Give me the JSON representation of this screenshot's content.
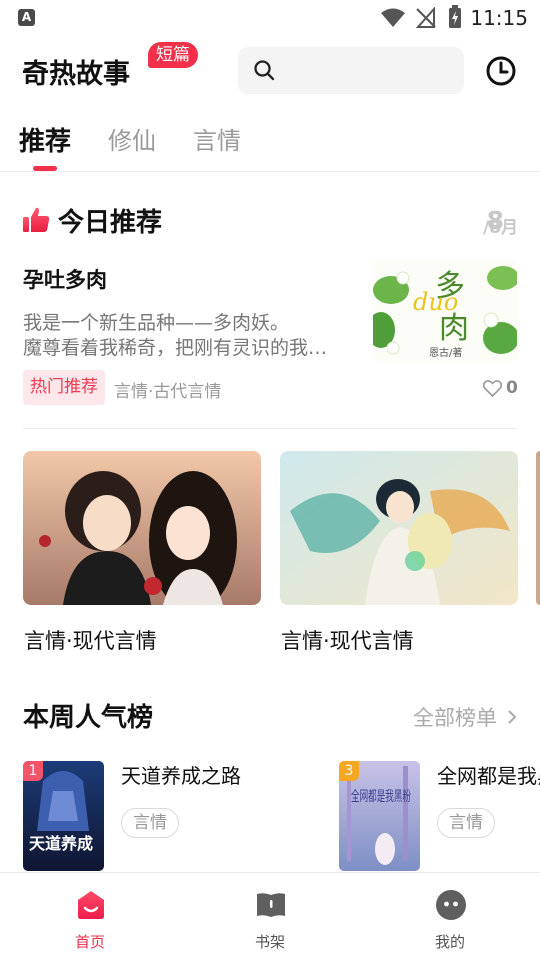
{
  "status_bar": {
    "time": "11:15",
    "notif_letter": "A"
  },
  "header": {
    "app_title": "奇热故事",
    "badge": "短篇"
  },
  "tabs": [
    {
      "label": "推荐"
    },
    {
      "label": "修仙"
    },
    {
      "label": "言情"
    }
  ],
  "today": {
    "title": "今日推荐",
    "date_num": "8",
    "date_den": "/8月",
    "book": {
      "title": "孕吐多肉",
      "desc_line1": "我是一个新生品种——多肉妖。",
      "desc_line2": "魔尊看着我稀奇，把刚有灵识的我带回魔界",
      "tag": "热门推荐",
      "genre": "言情·古代言情",
      "likes": "0",
      "cover_text": "孕吐多肉",
      "cover_author": "恩古/著"
    }
  },
  "featured": [
    {
      "label": "言情·现代言情"
    },
    {
      "label": "言情·现代言情"
    }
  ],
  "weekly": {
    "title": "本周人气榜",
    "more": "全部榜单",
    "items": [
      {
        "rank": "1",
        "title": "天道养成之路",
        "tag": "言情",
        "cover_text": "天道养成",
        "rank_color": "#f2546a"
      },
      {
        "rank": "3",
        "title": "全网都是我黑粉",
        "tag": "言情",
        "cover_text": "全网都是我黑粉",
        "rank_color": "#f5a623"
      }
    ]
  },
  "bottom_nav": [
    {
      "label": "首页",
      "icon": "home-icon"
    },
    {
      "label": "书架",
      "icon": "bookshelf-icon"
    },
    {
      "label": "我的",
      "icon": "profile-icon"
    }
  ],
  "colors": {
    "accent": "#f2304a",
    "muted": "#999999"
  }
}
